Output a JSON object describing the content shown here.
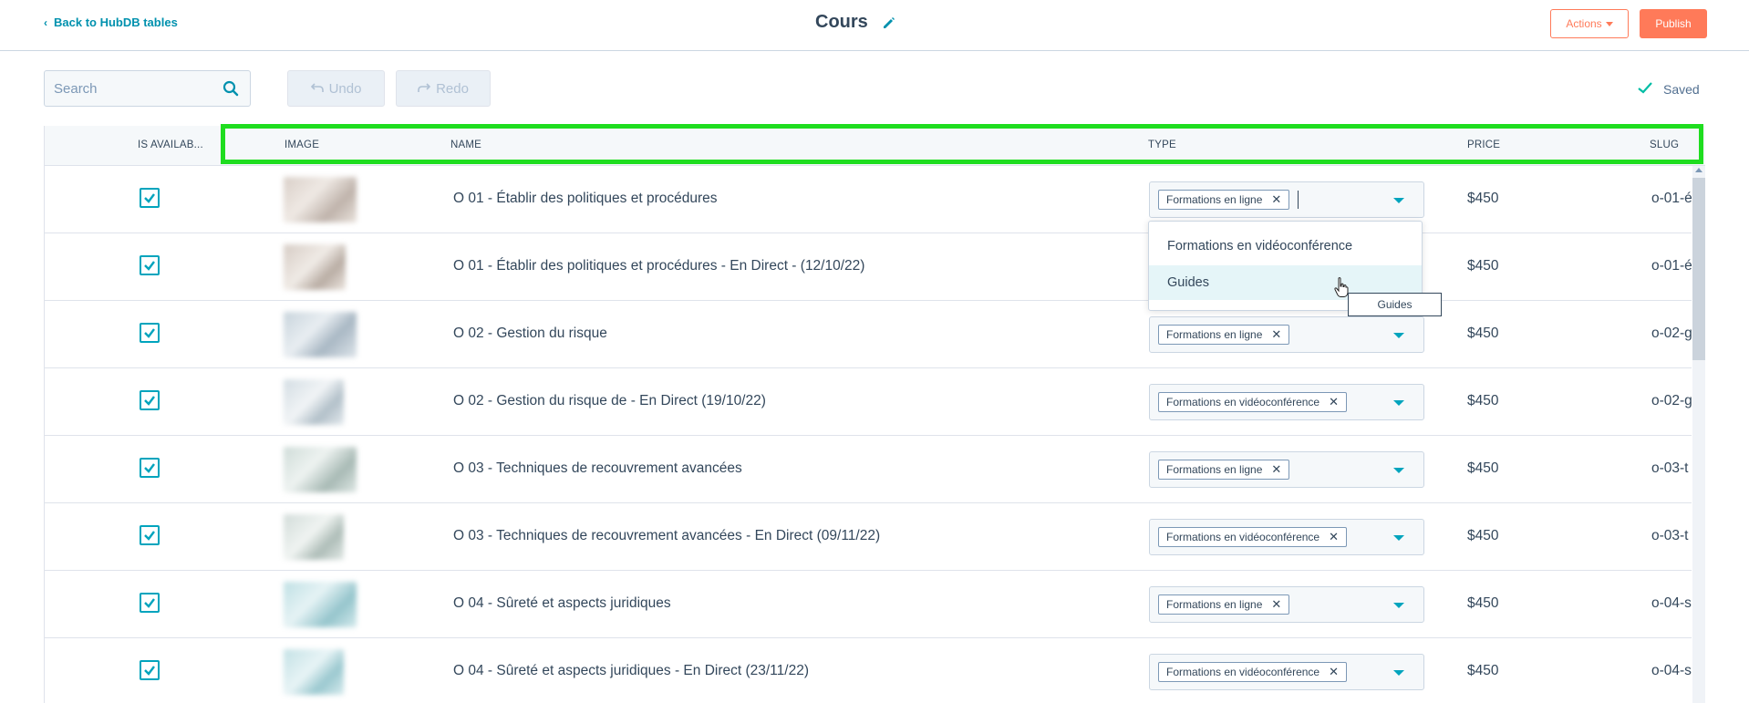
{
  "header": {
    "back_label": "Back to HubDB tables",
    "title": "Cours",
    "actions_label": "Actions",
    "publish_label": "Publish"
  },
  "toolbar": {
    "search_placeholder": "Search",
    "undo_label": "Undo",
    "redo_label": "Redo",
    "saved_label": "Saved"
  },
  "columns": [
    "IS AVAILAB...",
    "IMAGE",
    "NAME",
    "TYPE",
    "PRICE",
    "SLUG"
  ],
  "rows": [
    {
      "available": true,
      "name": "O 01 - Établir des politiques et procédures",
      "type": "Formations en ligne",
      "price": "$450",
      "slug": "o-01-é"
    },
    {
      "available": true,
      "name": "O 01 - Établir des politiques et procédures - En Direct - (12/10/22)",
      "type": "",
      "price": "$450",
      "slug": "o-01-é"
    },
    {
      "available": true,
      "name": "O 02 - Gestion du risque",
      "type": "Formations en ligne",
      "price": "$450",
      "slug": "o-02-g"
    },
    {
      "available": true,
      "name": "O 02 - Gestion du risque de - En Direct (19/10/22)",
      "type": "Formations en vidéoconférence",
      "price": "$450",
      "slug": "o-02-g"
    },
    {
      "available": true,
      "name": "O 03 - Techniques de recouvrement avancées",
      "type": "Formations en ligne",
      "price": "$450",
      "slug": "o-03-t"
    },
    {
      "available": true,
      "name": "O 03 - Techniques de recouvrement avancées - En Direct (09/11/22)",
      "type": "Formations en vidéoconférence",
      "price": "$450",
      "slug": "o-03-t"
    },
    {
      "available": true,
      "name": "O 04 - Sûreté et aspects juridiques",
      "type": "Formations en ligne",
      "price": "$450",
      "slug": "o-04-s"
    },
    {
      "available": true,
      "name": "O 04 - Sûreté et aspects juridiques - En Direct (23/11/22)",
      "type": "Formations en vidéoconférence",
      "price": "$450",
      "slug": "o-04-s"
    }
  ],
  "dropdown": {
    "options": [
      "Formations en vidéoconférence",
      "Guides"
    ],
    "hovered_index": 1,
    "tooltip": "Guides"
  },
  "colors": {
    "accent": "#00a4bd",
    "brand_orange": "#ff7a59",
    "highlight": "#1fdd1f",
    "text": "#33475b"
  },
  "icons": {
    "back": "chevron-left-icon",
    "edit": "pencil-icon",
    "search": "search-icon",
    "undo": "undo-icon",
    "redo": "redo-icon",
    "saved": "check-icon",
    "checkbox": "checkbox-checked-icon",
    "remove_tag": "close-icon",
    "dropdown": "caret-down-icon"
  }
}
